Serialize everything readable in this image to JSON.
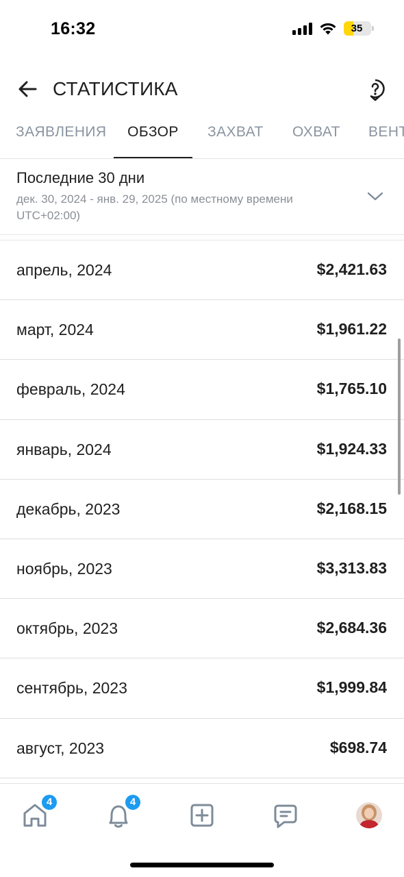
{
  "status_bar": {
    "time": "16:32",
    "battery_level": "35",
    "battery_color": "#ffd60a",
    "icons": [
      "cellular-signal-icon",
      "wifi-icon",
      "battery-icon"
    ]
  },
  "header": {
    "title": "СТАТИСТИКА",
    "back_icon": "arrow-left-icon",
    "help_icon": "help-circle-icon"
  },
  "tabs": [
    {
      "label": "ЗАЯВЛЕНИЯ",
      "active": false
    },
    {
      "label": "ОБЗОР",
      "active": true
    },
    {
      "label": "ЗАХВАТ",
      "active": false
    },
    {
      "label": "ОХВАТ",
      "active": false
    },
    {
      "label": "ВЕНТ",
      "active": false
    }
  ],
  "period": {
    "title": "Последние 30 дни",
    "range": "дек. 30, 2024 - янв. 29, 2025 (по местному времени UTC+02:00)"
  },
  "rows": [
    {
      "month": "апрель, 2024",
      "amount": "$2,421.63"
    },
    {
      "month": "март, 2024",
      "amount": "$1,961.22"
    },
    {
      "month": "февраль, 2024",
      "amount": "$1,765.10"
    },
    {
      "month": "январь, 2024",
      "amount": "$1,924.33"
    },
    {
      "month": "декабрь, 2023",
      "amount": "$2,168.15"
    },
    {
      "month": "ноябрь, 2023",
      "amount": "$3,313.83"
    },
    {
      "month": "октябрь, 2023",
      "amount": "$2,684.36"
    },
    {
      "month": "сентябрь, 2023",
      "amount": "$1,999.84"
    },
    {
      "month": "август, 2023",
      "amount": "$698.74"
    }
  ],
  "bottom_nav": {
    "home_badge": "4",
    "notifications_badge": "4",
    "badge_color": "#1d9bf0"
  }
}
